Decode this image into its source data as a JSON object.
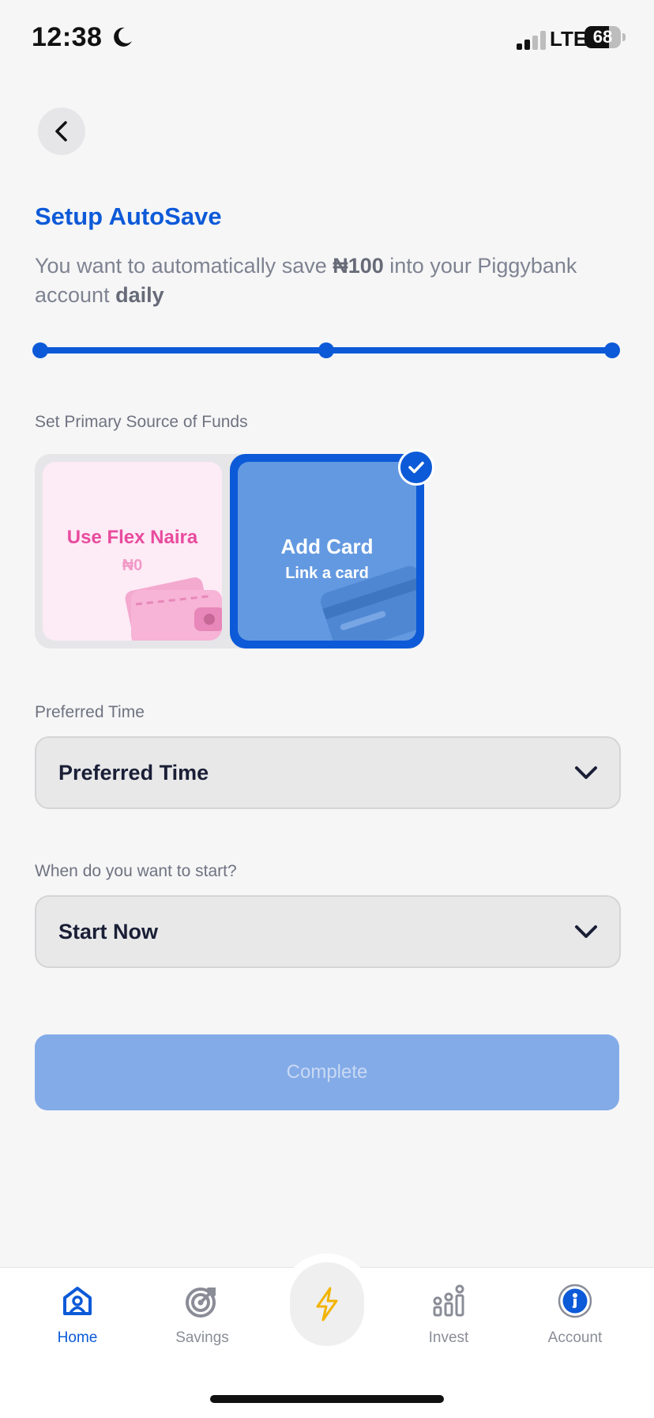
{
  "status_bar": {
    "time": "12:38",
    "network": "LTE",
    "battery": "68",
    "battery_level": 0.68
  },
  "header": {
    "title": "Setup AutoSave",
    "subtitle_parts": {
      "prefix": "You want to automatically save ",
      "amount": "₦100",
      "middle": " into your Piggybank account ",
      "frequency": "daily"
    }
  },
  "progress": {
    "steps": 3,
    "completed": 3
  },
  "funds": {
    "label": "Set Primary Source of Funds",
    "flex": {
      "title": "Use Flex Naira",
      "amount": "₦0"
    },
    "card": {
      "title": "Add Card",
      "subtitle": "Link a card",
      "selected": true
    }
  },
  "preferred_time": {
    "label": "Preferred Time",
    "value": "Preferred Time"
  },
  "start": {
    "label": "When do you want to start?",
    "value": "Start Now"
  },
  "complete_button": {
    "label": "Complete",
    "enabled": false
  },
  "nav": {
    "items": [
      {
        "label": "Home",
        "icon": "home-icon",
        "active": true
      },
      {
        "label": "Savings",
        "icon": "target-icon"
      },
      {
        "label": "",
        "icon": "lightning-icon"
      },
      {
        "label": "Invest",
        "icon": "invest-icon"
      },
      {
        "label": "Account",
        "icon": "account-icon"
      }
    ]
  },
  "colors": {
    "accent": "#0d5ad8",
    "flex_pink": "#e84b9e",
    "complete_disabled": "#83abe8"
  }
}
